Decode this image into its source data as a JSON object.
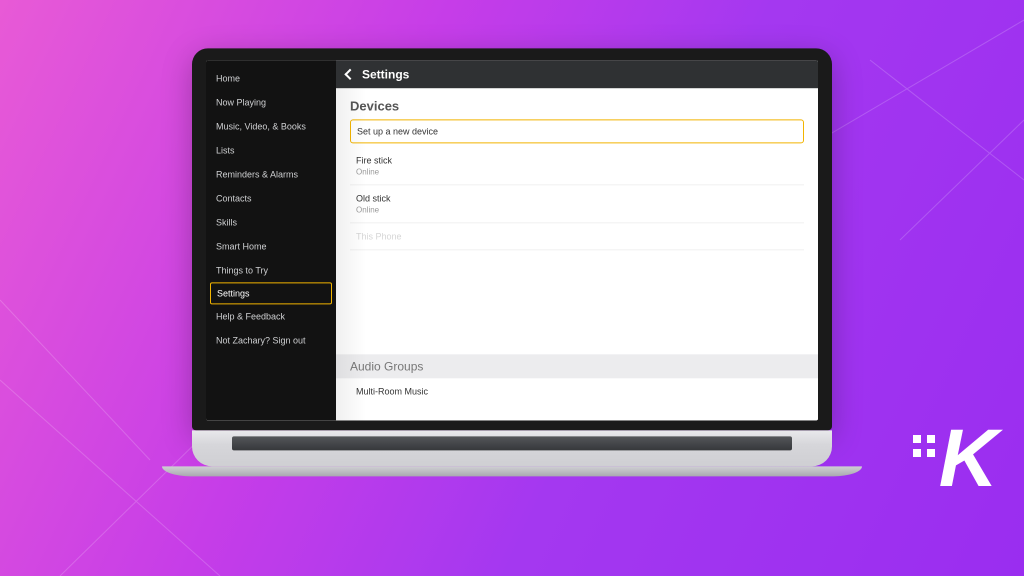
{
  "sidebar": {
    "items": [
      {
        "label": "Home"
      },
      {
        "label": "Now Playing"
      },
      {
        "label": "Music, Video, & Books"
      },
      {
        "label": "Lists"
      },
      {
        "label": "Reminders & Alarms"
      },
      {
        "label": "Contacts"
      },
      {
        "label": "Skills"
      },
      {
        "label": "Smart Home"
      },
      {
        "label": "Things to Try"
      },
      {
        "label": "Settings",
        "active": true
      },
      {
        "label": "Help & Feedback"
      },
      {
        "label": "Not Zachary? Sign out"
      }
    ]
  },
  "header": {
    "title": "Settings"
  },
  "devices": {
    "heading": "Devices",
    "setup": "Set up a new device",
    "list": [
      {
        "name": "Fire stick",
        "status": "Online"
      },
      {
        "name": "Old stick",
        "status": "Online"
      },
      {
        "name": "This Phone",
        "status": ""
      }
    ]
  },
  "audio": {
    "heading": "Audio Groups",
    "item": "Multi-Room Music"
  }
}
